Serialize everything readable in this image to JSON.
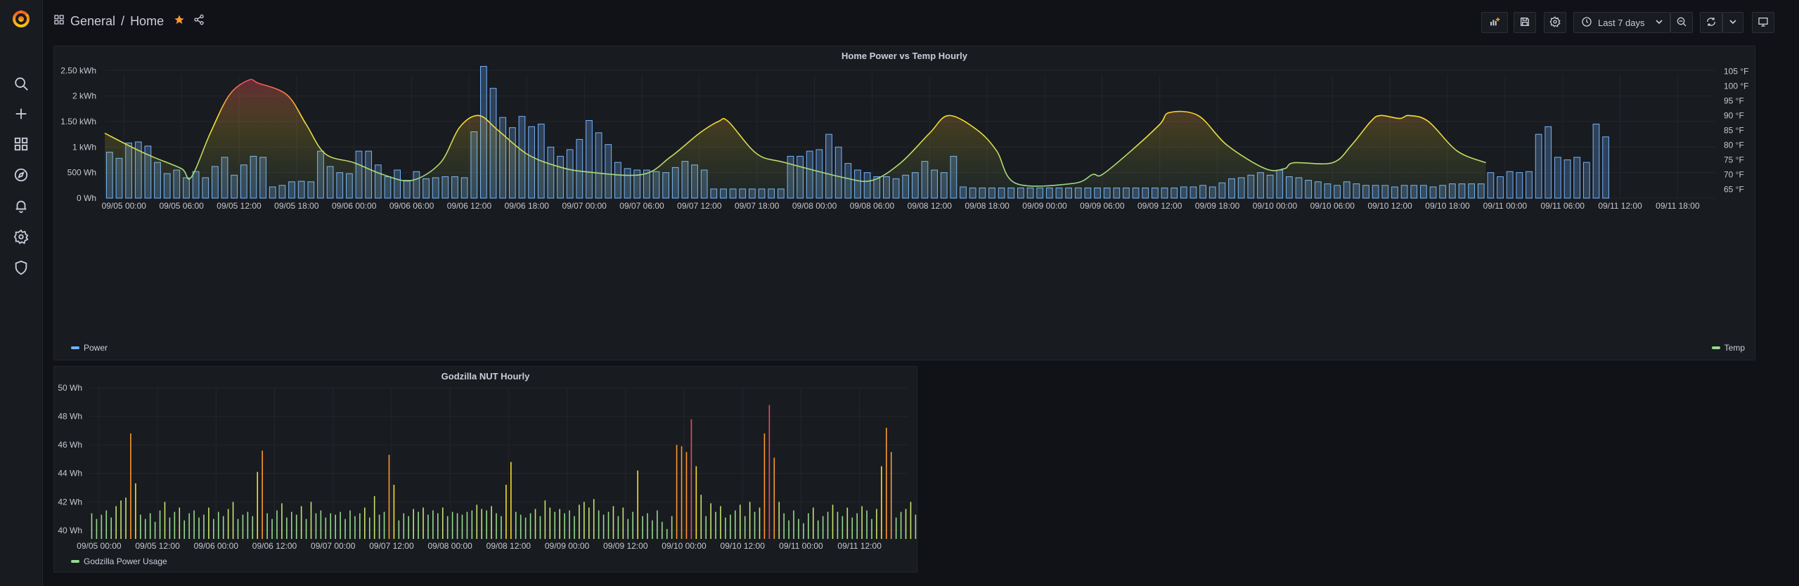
{
  "breadcrumb": {
    "folder": "General",
    "separator": "/",
    "dashboard": "Home"
  },
  "toolbar": {
    "time_range": "Last 7 days"
  },
  "colors": {
    "power": "#73b3ff",
    "temp": "#fade2a",
    "ups": "#96d98d",
    "hot": "#f2495c"
  },
  "icons": [
    "grafana-logo-icon",
    "search-icon",
    "plus-icon",
    "dashboards-icon",
    "explore-icon",
    "alert-bell-icon",
    "gear-icon",
    "shield-icon",
    "grid-icon",
    "star-icon",
    "share-icon",
    "add-panel-icon",
    "save-icon",
    "settings-icon",
    "clock-icon",
    "chevron-down-icon",
    "zoom-out-icon",
    "refresh-icon",
    "tv-icon"
  ],
  "panel1": {
    "title": "Home Power vs Temp Hourly",
    "y_ticks": [
      "0 Wh",
      "500 Wh",
      "1 kWh",
      "1.50 kWh",
      "2 kWh",
      "2.50 kWh"
    ],
    "y2_ticks": [
      "65 °F",
      "70 °F",
      "75 °F",
      "80 °F",
      "85 °F",
      "90 °F",
      "95 °F",
      "100 °F",
      "105 °F"
    ],
    "x_ticks": [
      "09/05 00:00",
      "09/05 06:00",
      "09/05 12:00",
      "09/05 18:00",
      "09/06 00:00",
      "09/06 06:00",
      "09/06 12:00",
      "09/06 18:00",
      "09/07 00:00",
      "09/07 06:00",
      "09/07 12:00",
      "09/07 18:00",
      "09/08 00:00",
      "09/08 06:00",
      "09/08 12:00",
      "09/08 18:00",
      "09/09 00:00",
      "09/09 06:00",
      "09/09 12:00",
      "09/09 18:00",
      "09/10 00:00",
      "09/10 06:00",
      "09/10 12:00",
      "09/10 18:00",
      "09/11 00:00",
      "09/11 06:00",
      "09/11 12:00",
      "09/11 18:00"
    ],
    "legend_left": "Power",
    "legend_right": "Temp"
  },
  "panel2": {
    "title": "Godzilla NUT Hourly",
    "y_ticks": [
      "40 Wh",
      "42 Wh",
      "44 Wh",
      "46 Wh",
      "48 Wh",
      "50 Wh"
    ],
    "x_ticks": [
      "09/05 00:00",
      "09/05 12:00",
      "09/06 00:00",
      "09/06 12:00",
      "09/07 00:00",
      "09/07 12:00",
      "09/08 00:00",
      "09/08 12:00",
      "09/09 00:00",
      "09/09 12:00",
      "09/10 00:00",
      "09/10 12:00",
      "09/11 00:00",
      "09/11 12:00"
    ],
    "legend": "Godzilla Power Usage"
  },
  "chart_data": [
    {
      "type": "bar",
      "title": "Home Power vs Temp Hourly",
      "x_range": [
        "09/04 22:00",
        "09/11 22:00"
      ],
      "ylim": [
        0,
        2.6
      ],
      "y2lim": [
        62,
        107
      ],
      "series": [
        {
          "name": "Power",
          "unit": "kWh",
          "start": "09/04 22:00",
          "step_hours": 1,
          "values": [
            0.9,
            0.78,
            1.08,
            1.1,
            1.02,
            0.7,
            0.48,
            0.55,
            0.4,
            0.52,
            0.4,
            0.62,
            0.8,
            0.45,
            0.65,
            0.82,
            0.8,
            0.22,
            0.25,
            0.32,
            0.33,
            0.32,
            0.92,
            0.62,
            0.5,
            0.48,
            0.92,
            0.92,
            0.65,
            0.42,
            0.55,
            0.35,
            0.52,
            0.38,
            0.4,
            0.42,
            0.42,
            0.4,
            1.3,
            2.58,
            2.15,
            1.58,
            1.38,
            1.6,
            1.4,
            1.45,
            1.0,
            0.82,
            0.95,
            1.15,
            1.52,
            1.28,
            1.05,
            0.7,
            0.58,
            0.55,
            0.55,
            0.52,
            0.5,
            0.6,
            0.72,
            0.65,
            0.55,
            0.18,
            0.18,
            0.18,
            0.18,
            0.18,
            0.18,
            0.18,
            0.18,
            0.82,
            0.82,
            0.92,
            0.95,
            1.25,
            1.0,
            0.68,
            0.55,
            0.5,
            0.42,
            0.42,
            0.38,
            0.45,
            0.5,
            0.72,
            0.55,
            0.5,
            0.82,
            0.22,
            0.2,
            0.2,
            0.2,
            0.2,
            0.2,
            0.2,
            0.2,
            0.2,
            0.2,
            0.2,
            0.2,
            0.2,
            0.2,
            0.2,
            0.2,
            0.2,
            0.2,
            0.2,
            0.2,
            0.2,
            0.2,
            0.2,
            0.22,
            0.22,
            0.25,
            0.22,
            0.3,
            0.38,
            0.4,
            0.45,
            0.5,
            0.45,
            0.55,
            0.42,
            0.4,
            0.35,
            0.32,
            0.28,
            0.25,
            0.32,
            0.28,
            0.25,
            0.25,
            0.25,
            0.22,
            0.25,
            0.25,
            0.25,
            0.22,
            0.25,
            0.28,
            0.28,
            0.28,
            0.28,
            0.5,
            0.42,
            0.52,
            0.5,
            0.52,
            1.25,
            1.4,
            0.8,
            0.75,
            0.8,
            0.7,
            1.45,
            1.2
          ]
        },
        {
          "name": "Temp",
          "unit": "°F",
          "points": [
            [
              "09/04 22:00",
              84
            ],
            [
              "09/05 01:00",
              79
            ],
            [
              "09/05 03:00",
              76
            ],
            [
              "09/05 06:00",
              72
            ],
            [
              "09/05 07:00",
              69
            ],
            [
              "09/05 09:00",
              84
            ],
            [
              "09/05 11:00",
              97
            ],
            [
              "09/05 13:00",
              102
            ],
            [
              "09/05 14:00",
              101
            ],
            [
              "09/05 17:00",
              97
            ],
            [
              "09/05 19:00",
              87
            ],
            [
              "09/05 21:00",
              77
            ],
            [
              "09/06 00:00",
              74
            ],
            [
              "09/06 03:00",
              70
            ],
            [
              "09/06 06:00",
              68
            ],
            [
              "09/06 09:00",
              74
            ],
            [
              "09/06 11:00",
              86
            ],
            [
              "09/06 13:00",
              90
            ],
            [
              "09/06 15:00",
              85
            ],
            [
              "09/06 18:00",
              77
            ],
            [
              "09/06 21:00",
              73
            ],
            [
              "09/07 00:00",
              71
            ],
            [
              "09/07 06:00",
              70
            ],
            [
              "09/07 09:00",
              76
            ],
            [
              "09/07 12:00",
              84
            ],
            [
              "09/07 14:00",
              88
            ],
            [
              "09/07 15:00",
              88
            ],
            [
              "09/07 18:00",
              77
            ],
            [
              "09/07 21:00",
              74
            ],
            [
              "09/08 03:00",
              69
            ],
            [
              "09/08 06:00",
              68
            ],
            [
              "09/08 09:00",
              74
            ],
            [
              "09/08 12:00",
              84
            ],
            [
              "09/08 14:00",
              90
            ],
            [
              "09/08 17:00",
              85
            ],
            [
              "09/08 19:00",
              78
            ],
            [
              "09/08 21:00",
              67
            ],
            [
              "09/09 03:00",
              67
            ],
            [
              "09/09 05:00",
              70
            ],
            [
              "09/09 06:00",
              70
            ],
            [
              "09/09 09:00",
              78
            ],
            [
              "09/09 12:00",
              87
            ],
            [
              "09/09 13:00",
              91
            ],
            [
              "09/09 16:00",
              90
            ],
            [
              "09/09 19:00",
              80
            ],
            [
              "09/09 23:00",
              72
            ],
            [
              "09/10 01:00",
              72
            ],
            [
              "09/10 02:00",
              74
            ],
            [
              "09/10 06:00",
              74
            ],
            [
              "09/10 08:00",
              80
            ],
            [
              "09/10 10:00",
              88
            ],
            [
              "09/10 11:00",
              90
            ],
            [
              "09/10 13:00",
              89
            ],
            [
              "09/10 14:00",
              90
            ],
            [
              "09/10 16:00",
              88
            ],
            [
              "09/10 19:00",
              78
            ],
            [
              "09/10 22:00",
              74
            ]
          ]
        }
      ]
    },
    {
      "type": "bar",
      "title": "Godzilla NUT Hourly",
      "x_range": [
        "09/04 22:00",
        "09/11 22:00"
      ],
      "ylim": [
        39.4,
        50
      ],
      "series": [
        {
          "name": "Godzilla Power Usage",
          "unit": "Wh",
          "start": "09/04 22:00",
          "step_hours": 1,
          "values": [
            41.2,
            40.8,
            41.1,
            41.4,
            40.9,
            41.7,
            42.1,
            42.3,
            46.8,
            43.3,
            41.1,
            40.8,
            41.2,
            40.6,
            41.4,
            42.0,
            40.9,
            41.3,
            41.6,
            40.7,
            41.2,
            41.4,
            40.9,
            41.1,
            41.6,
            40.8,
            41.3,
            41.0,
            41.5,
            42.0,
            40.8,
            41.1,
            41.3,
            41.0,
            44.1,
            45.6,
            41.2,
            40.8,
            41.4,
            41.9,
            40.9,
            41.3,
            41.1,
            41.7,
            40.8,
            42.0,
            41.2,
            41.4,
            40.9,
            41.2,
            41.1,
            41.3,
            40.8,
            41.4,
            41.0,
            41.2,
            41.6,
            40.9,
            42.4,
            41.1,
            41.3,
            45.3,
            43.2,
            40.7,
            41.2,
            41.0,
            41.5,
            41.3,
            41.6,
            41.1,
            41.4,
            41.2,
            41.6,
            41.0,
            41.3,
            41.2,
            41.1,
            41.3,
            41.4,
            41.8,
            41.5,
            41.4,
            41.7,
            41.2,
            41.0,
            43.2,
            44.8,
            41.3,
            41.1,
            40.9,
            41.2,
            41.5,
            41.0,
            42.1,
            41.6,
            41.3,
            41.5,
            41.2,
            41.4,
            41.0,
            41.8,
            42.0,
            41.6,
            42.2,
            41.4,
            41.1,
            41.3,
            41.7,
            41.0,
            41.6,
            40.8,
            41.3,
            44.2,
            41.0,
            41.2,
            40.7,
            41.4,
            40.6,
            40.1,
            41.0,
            46.0,
            45.9,
            45.5,
            47.8,
            44.5,
            42.5,
            41.0,
            41.9,
            41.3,
            41.7,
            40.9,
            41.1,
            41.4,
            41.8,
            41.0,
            42.0,
            41.3,
            41.6,
            46.8,
            48.8,
            45.1,
            42.0,
            41.2,
            40.7,
            41.4,
            40.8,
            40.5,
            41.2,
            41.6,
            40.7,
            41.0,
            41.3,
            41.8,
            41.3,
            41.0,
            41.6,
            40.9,
            41.2,
            41.7,
            41.4,
            40.8,
            41.5,
            44.5,
            47.2,
            45.5,
            40.9,
            41.3,
            41.5,
            42.0,
            41.1,
            40.8,
            41.5,
            41.2,
            41.4,
            41.1,
            40.9,
            41.3,
            40.6,
            41.0
          ]
        }
      ]
    }
  ]
}
